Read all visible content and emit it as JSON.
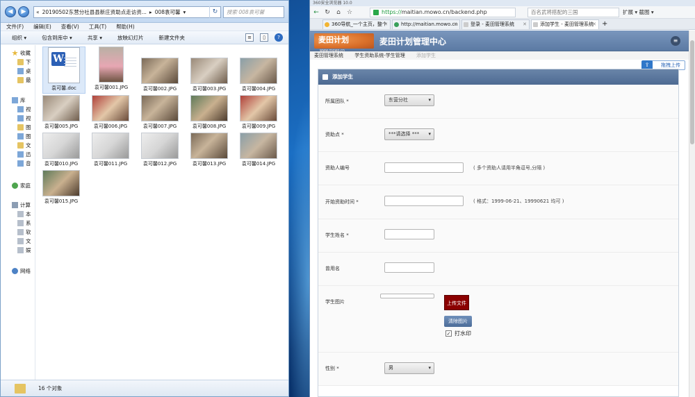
{
  "explorer": {
    "address_segments": [
      "«",
      "20190502东营分社县县新庄资助点走访资...",
      "▸",
      "008袁可馨",
      "▾"
    ],
    "search_placeholder": "搜索 008袁可馨",
    "menu": [
      "文件(F)",
      "编辑(E)",
      "查看(V)",
      "工具(T)",
      "帮助(H)"
    ],
    "toolbar": [
      "组织 ▾",
      "包含到库中 ▾",
      "共享 ▾",
      "放映幻灯片",
      "新建文件夹"
    ],
    "nav": {
      "favorites": "收藏",
      "fav_items": [
        "下",
        "桌",
        "最"
      ],
      "libraries": "库",
      "lib_items": [
        "视",
        "视",
        "图",
        "图",
        "文",
        "迅",
        "音"
      ],
      "homegroup": "家庭",
      "computer": "计算",
      "comp_items": [
        "本",
        "系",
        "软",
        "文",
        "娱"
      ],
      "network": "网络"
    },
    "files": [
      {
        "name": "袁可馨.doc",
        "kind": "doc"
      },
      {
        "name": "袁可馨001.JPG",
        "kind": "tall"
      },
      {
        "name": "袁可馨002.JPG",
        "kind": "p1"
      },
      {
        "name": "袁可馨003.JPG",
        "kind": "p2"
      },
      {
        "name": "袁可馨004.JPG",
        "kind": "p4"
      },
      {
        "name": "袁可馨005.JPG",
        "kind": "p2"
      },
      {
        "name": "袁可馨006.JPG",
        "kind": "p3"
      },
      {
        "name": "袁可馨007.JPG",
        "kind": "p1"
      },
      {
        "name": "袁可馨008.JPG",
        "kind": "p6"
      },
      {
        "name": "袁可馨009.JPG",
        "kind": "p3"
      },
      {
        "name": "袁可馨010.JPG",
        "kind": "p5"
      },
      {
        "name": "袁可馨011.JPG",
        "kind": "p5"
      },
      {
        "name": "袁可馨012.JPG",
        "kind": "p5"
      },
      {
        "name": "袁可馨013.JPG",
        "kind": "p1"
      },
      {
        "name": "袁可馨014.JPG",
        "kind": "p4"
      },
      {
        "name": "袁可馨015.JPG",
        "kind": "p6"
      }
    ],
    "status": "16 个对象"
  },
  "browser": {
    "title": "360安全浏览器 10.0",
    "url_https": "https://",
    "url_host": "maitian.mowo.cn",
    "url_path": "/backend.php",
    "search_text": "百名武将搭配的三国",
    "extra": "扩展 ▾   截图 ▾",
    "tabs": [
      {
        "label": "360导航_一个主页，整个"
      },
      {
        "label": "http://maitian.mowo.cn"
      },
      {
        "label": "登录 - 麦田管理系统"
      },
      {
        "label": "添加学生 - 麦田管理系统"
      }
    ],
    "site": {
      "logo": "麦田计划",
      "logo_sub": "www.mowo.cn",
      "title": "麦田计划管理中心",
      "crumbs": [
        "麦田管理系统",
        "学生资助系统-学生管理",
        "添加学生"
      ],
      "quick_upload": "拖拽上传"
    },
    "form": {
      "heading": "添加学生",
      "fields": {
        "team_label": "所属团队 *",
        "team_value": "东营分社",
        "aid_label": "资助点 *",
        "aid_value": "***请选择 ***",
        "donor_label": "资助人编号",
        "donor_hint": "( 多个资助人请用半角逗号,分隔 )",
        "start_label": "开始资助时间 *",
        "start_hint": "( 格式：1999-06-21、19990621 均可 )",
        "name_label": "学生姓名 *",
        "alias_label": "曾用名",
        "photo_label": "学生图片",
        "upload_btn": "上传文件",
        "clear_btn": "清除图片",
        "watermark_label": "打水印",
        "watermark_mark": "✓",
        "gender_label": "性别 *",
        "gender_value": "男"
      }
    }
  }
}
